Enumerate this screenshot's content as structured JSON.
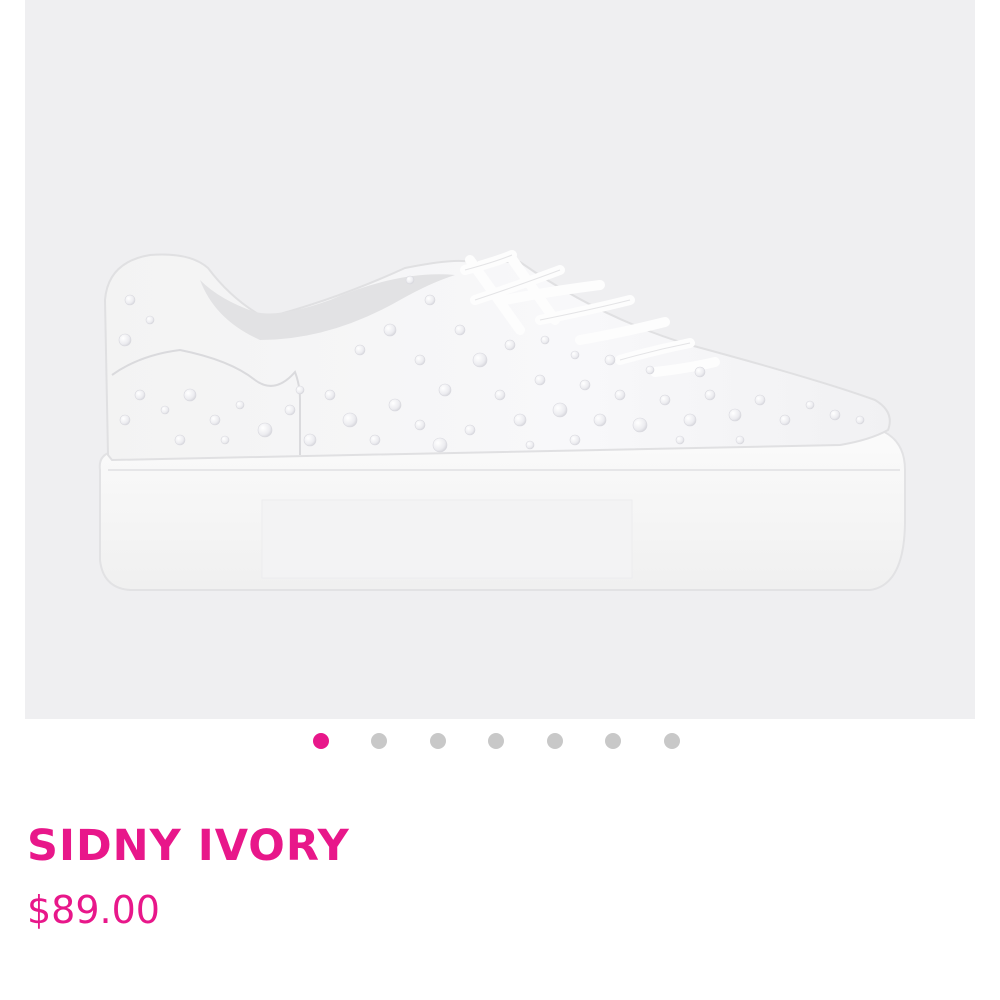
{
  "product": {
    "name": "SIDNY IVORY",
    "price": "$89.00",
    "image_alt": "SIDNY IVORY"
  },
  "gallery": {
    "total_images": 7,
    "active_index": 0
  },
  "colors": {
    "accent": "#e8178a",
    "dot_inactive": "#c8c8c8",
    "image_background": "#efeff1"
  },
  "icons": {
    "pagination_dot": "circle"
  }
}
